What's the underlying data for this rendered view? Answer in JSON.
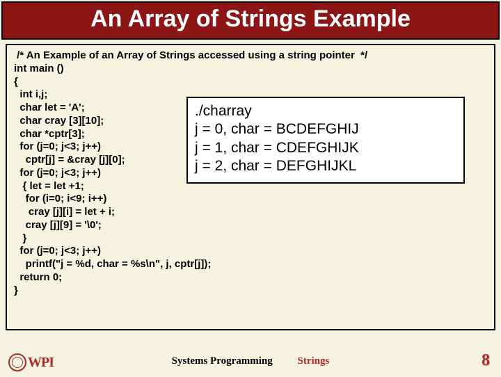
{
  "title": "An Array of Strings Example",
  "code": " /* An Example of an Array of Strings accessed using a string pointer  */\nint main ()\n{\n  int i,j;\n  char let = 'A';\n  char cray [3][10];\n  char *cptr[3];\n  for (j=0; j<3; j++)\n    cptr[j] = &cray [j][0];\n  for (j=0; j<3; j++)\n   { let = let +1;\n    for (i=0; i<9; i++)\n     cray [j][i] = let + i;\n    cray [j][9] = '\\0';\n   }\n  for (j=0; j<3; j++)\n    printf(\"j = %d, char = %s\\n\", j, cptr[j]);\n  return 0;\n}",
  "output": "./charray\nj = 0, char = BCDEFGHIJ\nj = 1, char = CDEFGHIJK\nj = 2, char = DEFGHIJKL",
  "footer": {
    "course": "Systems Programming",
    "topic": "Strings",
    "logo_text": "WPI",
    "page": "8"
  }
}
